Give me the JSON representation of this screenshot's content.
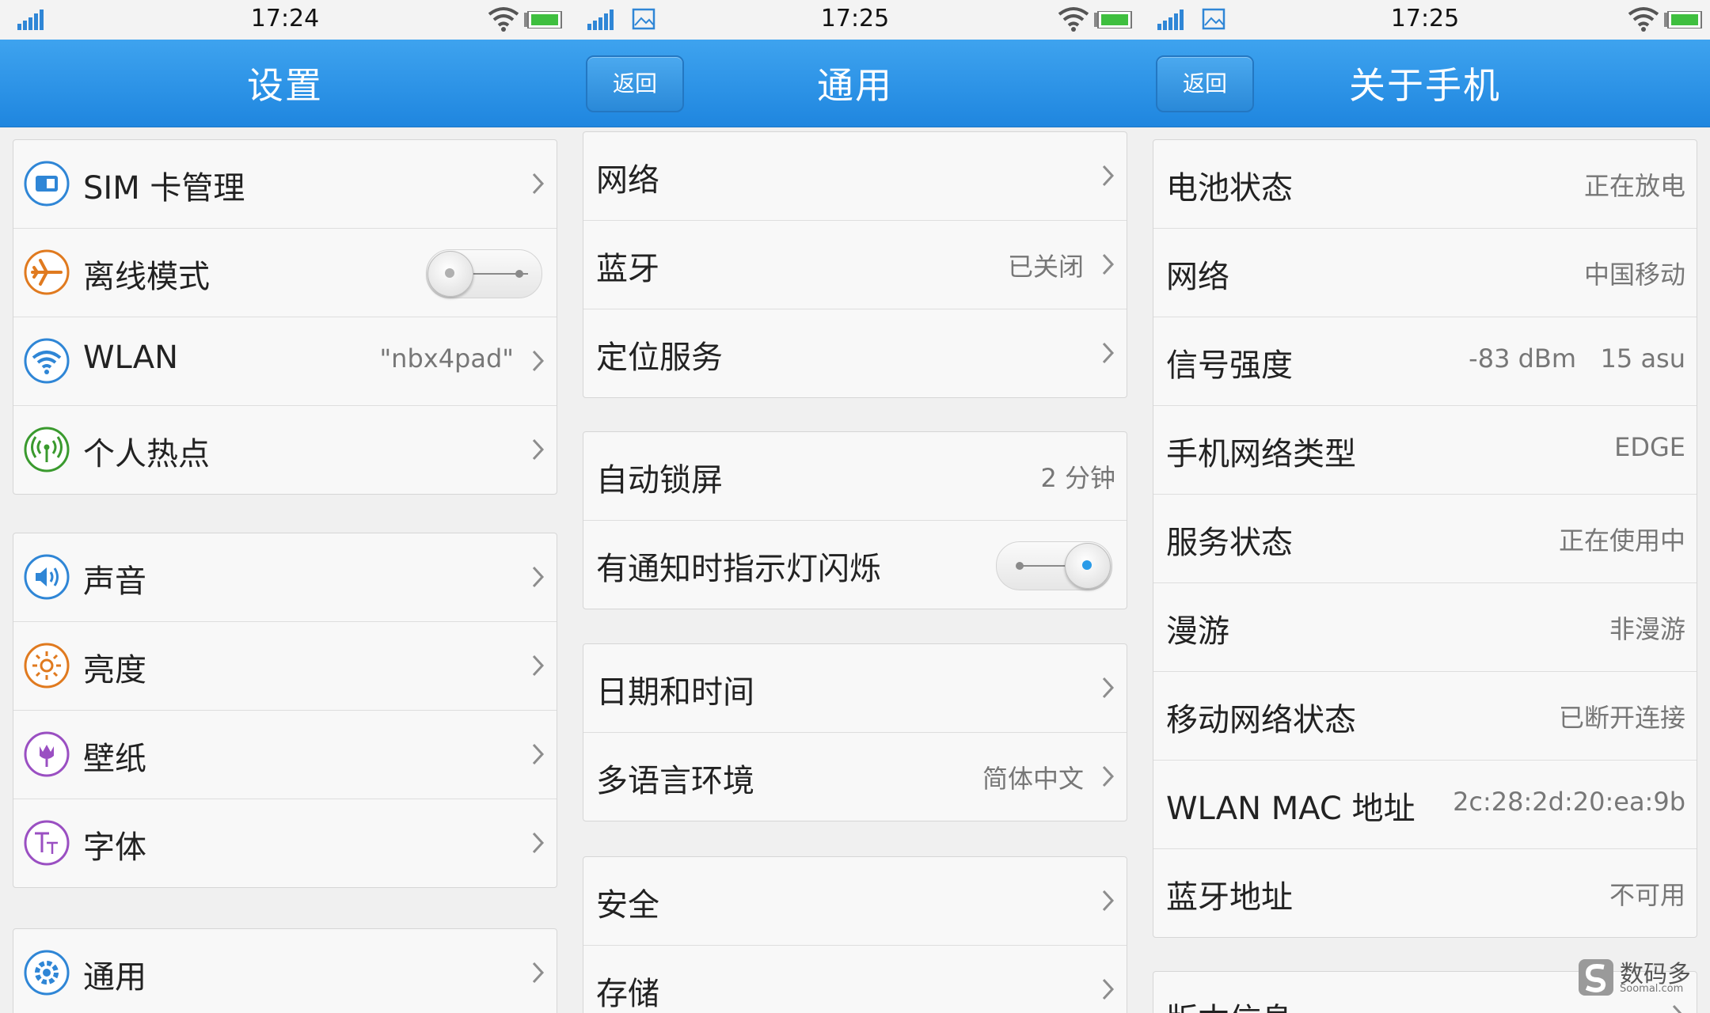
{
  "screens": [
    {
      "time": "17:24",
      "title": "设置",
      "groups": [
        [
          {
            "label": "SIM 卡管理",
            "icon": "sim-card-icon"
          },
          {
            "label": "离线模式",
            "icon": "airplane-icon",
            "toggle": "off"
          },
          {
            "label": "WLAN",
            "icon": "wifi-icon",
            "value": "\"nbx4pad\""
          },
          {
            "label": "个人热点",
            "icon": "hotspot-icon"
          }
        ],
        [
          {
            "label": "声音",
            "icon": "sound-icon"
          },
          {
            "label": "亮度",
            "icon": "brightness-icon"
          },
          {
            "label": "壁纸",
            "icon": "wallpaper-icon"
          },
          {
            "label": "字体",
            "icon": "font-icon"
          }
        ],
        [
          {
            "label": "通用",
            "icon": "gear-icon"
          }
        ]
      ]
    },
    {
      "time": "17:25",
      "title": "通用",
      "back_label": "返回",
      "groups": [
        [
          {
            "label": "网络"
          },
          {
            "label": "蓝牙",
            "value": "已关闭"
          },
          {
            "label": "定位服务"
          }
        ],
        [
          {
            "label": "自动锁屏",
            "value": "2 分钟"
          },
          {
            "label": "有通知时指示灯闪烁",
            "toggle": "on"
          }
        ],
        [
          {
            "label": "日期和时间"
          },
          {
            "label": "多语言环境",
            "value": "简体中文"
          }
        ],
        [
          {
            "label": "安全"
          },
          {
            "label": "存储"
          }
        ]
      ]
    },
    {
      "time": "17:25",
      "title": "关于手机",
      "back_label": "返回",
      "groups": [
        [
          {
            "label": "电池状态",
            "value": "正在放电"
          },
          {
            "label": "网络",
            "value": "中国移动"
          },
          {
            "label": "信号强度",
            "value": "-83 dBm   15 asu"
          },
          {
            "label": "手机网络类型",
            "value": "EDGE"
          },
          {
            "label": "服务状态",
            "value": "正在使用中"
          },
          {
            "label": "漫游",
            "value": "非漫游"
          },
          {
            "label": "移动网络状态",
            "value": "已断开连接"
          },
          {
            "label": "WLAN MAC 地址",
            "value": "2c:28:2d:20:ea:9b"
          },
          {
            "label": "蓝牙地址",
            "value": "不可用"
          }
        ],
        [
          {
            "label": "版本信息"
          }
        ]
      ]
    }
  ],
  "watermark": {
    "name": "数码多",
    "site": "Soomal.com"
  },
  "colors": {
    "header_top": "#3ea3ef",
    "header_bottom": "#1f86df",
    "icon_blue": "#2f86d6",
    "icon_orange": "#e07a1f",
    "icon_green": "#3a9a2e",
    "icon_purple": "#9a4fc2",
    "toggle_on_dot": "#2a9be8"
  }
}
